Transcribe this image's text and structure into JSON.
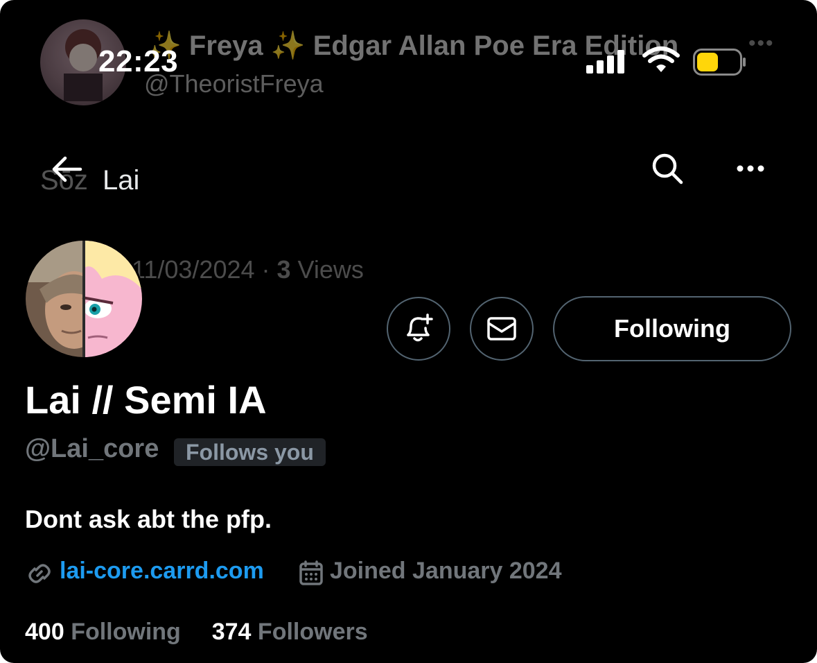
{
  "status_bar": {
    "time": "22:23"
  },
  "background_screen": {
    "title": "✨ Freya ✨ Edgar Allan Poe Era Edition",
    "handle": "@TheoristFreya",
    "more": "•••",
    "previous_name_fragment": "Sōz",
    "date_views_prefix": "11/03/2024 · ",
    "views_count": "3",
    "views_label": " Views"
  },
  "nav": {
    "title": "Lai"
  },
  "profile": {
    "display_name": "Lai // Semi IA",
    "handle": "@Lai_core",
    "follows_you": "Follows you",
    "bio": "Dont ask abt the pfp.",
    "website": "lai-core.carrd.com",
    "joined": "Joined January 2024",
    "following_count": "400",
    "following_label": "Following",
    "followers_count": "374",
    "followers_label": "Followers"
  },
  "actions": {
    "following_button": "Following"
  },
  "icons": {
    "back": "back-arrow-icon",
    "search": "search-icon",
    "more": "more-icon",
    "notify": "bell-plus-icon",
    "message": "mail-icon",
    "link": "link-icon",
    "calendar": "calendar-icon"
  },
  "colors": {
    "background": "#000000",
    "link": "#1d9bf0",
    "muted": "#71767b",
    "border": "#536471",
    "battery": "#ffd60a"
  }
}
